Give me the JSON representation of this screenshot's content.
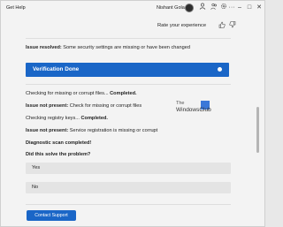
{
  "titlebar": {
    "app_title": "Get Help",
    "user_name": "Nishant Gola"
  },
  "rating": {
    "label": "Rate your experience"
  },
  "content": {
    "issue_resolved_prefix": "Issue resolved:",
    "issue_resolved_text": " Some security settings are missing or have been changed",
    "verification_label": "Verification Done",
    "checking_files_prefix": "Checking for missing or corrupt files... ",
    "checking_files_status": "Completed.",
    "issue_not_present_1_prefix": "Issue not present:",
    "issue_not_present_1_text": " Check for missing or corrupt files",
    "checking_registry_prefix": "Checking registry keys... ",
    "checking_registry_status": "Completed.",
    "issue_not_present_2_prefix": "Issue not present:",
    "issue_not_present_2_text": " Service registration is missing or corrupt",
    "diagnostic_complete": "Diagnostic scan completed!",
    "question": "Did this solve the problem?",
    "answers": [
      "Yes",
      "No"
    ]
  },
  "watermark": {
    "line1": "The",
    "line2": "WindowsClub"
  },
  "footer": {
    "contact_label": "Contact Support"
  },
  "colors": {
    "accent": "#1a66c7",
    "answer_bg": "#e4e4e4",
    "window_bg": "#f3f3f3"
  },
  "icons": {
    "titlebar": [
      "person-icon",
      "people-icon",
      "settings-icon",
      "more-icon"
    ],
    "window_controls": [
      "minimize-icon",
      "maximize-icon",
      "close-icon"
    ],
    "rating": [
      "thumbs-up-icon",
      "thumbs-down-icon"
    ]
  }
}
